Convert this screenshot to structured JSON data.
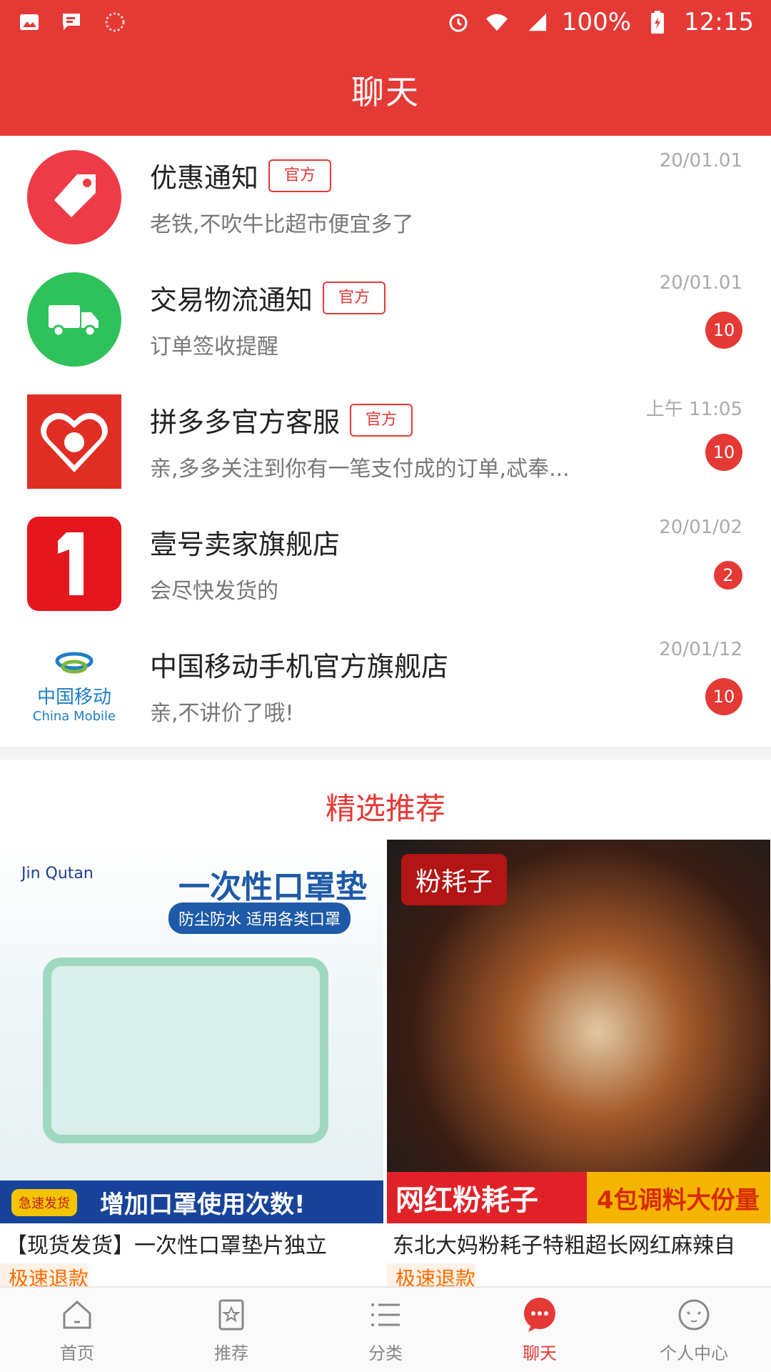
{
  "status_bar": {
    "battery": "100%",
    "time": "12:15",
    "network": "4G"
  },
  "header": {
    "title": "聊天"
  },
  "chats": [
    {
      "name": "优惠通知",
      "official": "官方",
      "preview": "老铁,不吹牛比超市便宜多了",
      "time": "20/01.01",
      "badge": ""
    },
    {
      "name": "交易物流通知",
      "official": "官方",
      "preview": "订单签收提醒",
      "time": "20/01.01",
      "badge": "10"
    },
    {
      "name": "拼多多官方客服",
      "official": "官方",
      "preview": "亲,多多关注到你有一笔支付成的订单,忒奉...",
      "time": "上午 11:05",
      "badge": "10"
    },
    {
      "name": "壹号卖家旗舰店",
      "official": "",
      "preview": "会尽快发货的",
      "time": "20/01/02",
      "badge": "2"
    },
    {
      "name": "中国移动手机官方旗舰店",
      "official": "",
      "preview": "亲,不讲价了哦!",
      "time": "20/01/12",
      "badge": "10"
    }
  ],
  "china_mobile_logo": {
    "cn": "中国移动",
    "en": "China Mobile"
  },
  "section": {
    "title": "精选推荐"
  },
  "products": [
    {
      "title": "【现货发货】一次性口罩垫片独立",
      "tag": "极速退款",
      "brand": "Jin Qutan",
      "heading": "一次性口罩垫",
      "sub": "防尘防水 适用各类口罩",
      "banner": "增加口罩使用次数!",
      "badge": "急速发货"
    },
    {
      "title": "东北大妈粉耗子特粗超长网红麻辣自",
      "tag": "极速退款",
      "label": "粉耗子",
      "banner_left": "网红粉耗子",
      "banner_right": "4包调料大份量"
    }
  ],
  "nav": [
    {
      "label": "首页",
      "icon": "home-icon",
      "active": false
    },
    {
      "label": "推荐",
      "icon": "star-bookmark-icon",
      "active": false
    },
    {
      "label": "分类",
      "icon": "list-icon",
      "active": false
    },
    {
      "label": "聊天",
      "icon": "chat-bubble-icon",
      "active": true
    },
    {
      "label": "个人中心",
      "icon": "face-icon",
      "active": false
    }
  ],
  "colors": {
    "primary": "#e53935",
    "badge": "#e53935",
    "accent_orange": "#ff6d00"
  }
}
